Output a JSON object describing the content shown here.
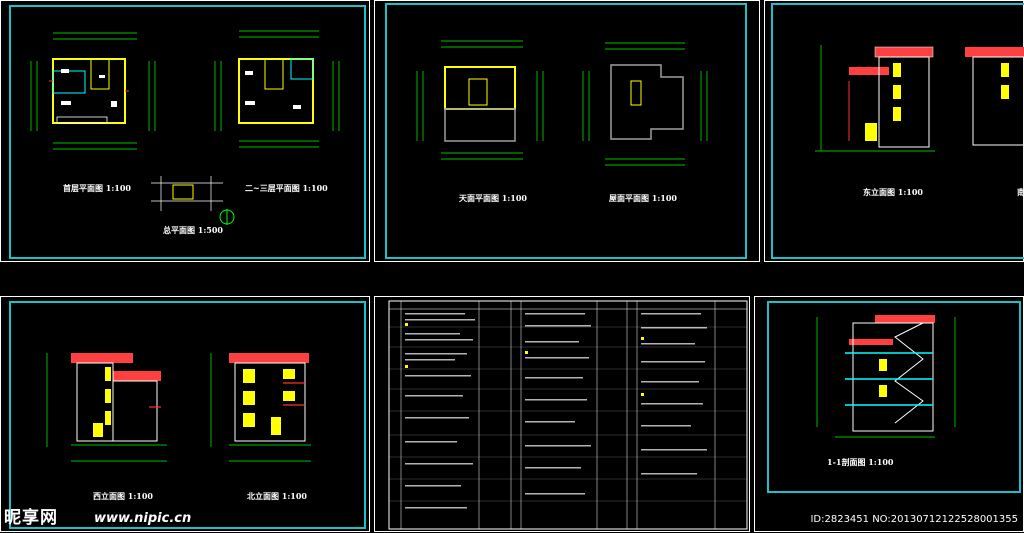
{
  "sheets": {
    "sheet1": {
      "label_first_floor": "首层平面图 1:100",
      "label_2_3_floor": "二~三层平面图 1:100",
      "label_site": "总平面图 1:500"
    },
    "sheet2": {
      "label_roof_terrace": "天面平面图 1:100",
      "label_roof": "屋面平面图 1:100"
    },
    "sheet3": {
      "label_east": "东立面图 1:100",
      "label_partial": "南"
    },
    "sheet4": {
      "label_west": "西立面图 1:100",
      "label_north": "北立面图 1:100"
    },
    "sheet6": {
      "label_section": "1-1剖面图 1:100"
    }
  },
  "watermark": {
    "logo": "昵享网",
    "url": "www.nipic.cn",
    "id": "ID:2823451 NO:20130712122528001355"
  },
  "colors": {
    "frame": "#19c2c8",
    "wall": "#ffff00",
    "dim": "#00ff00",
    "axis": "#00ffff",
    "red": "#ff3030"
  }
}
